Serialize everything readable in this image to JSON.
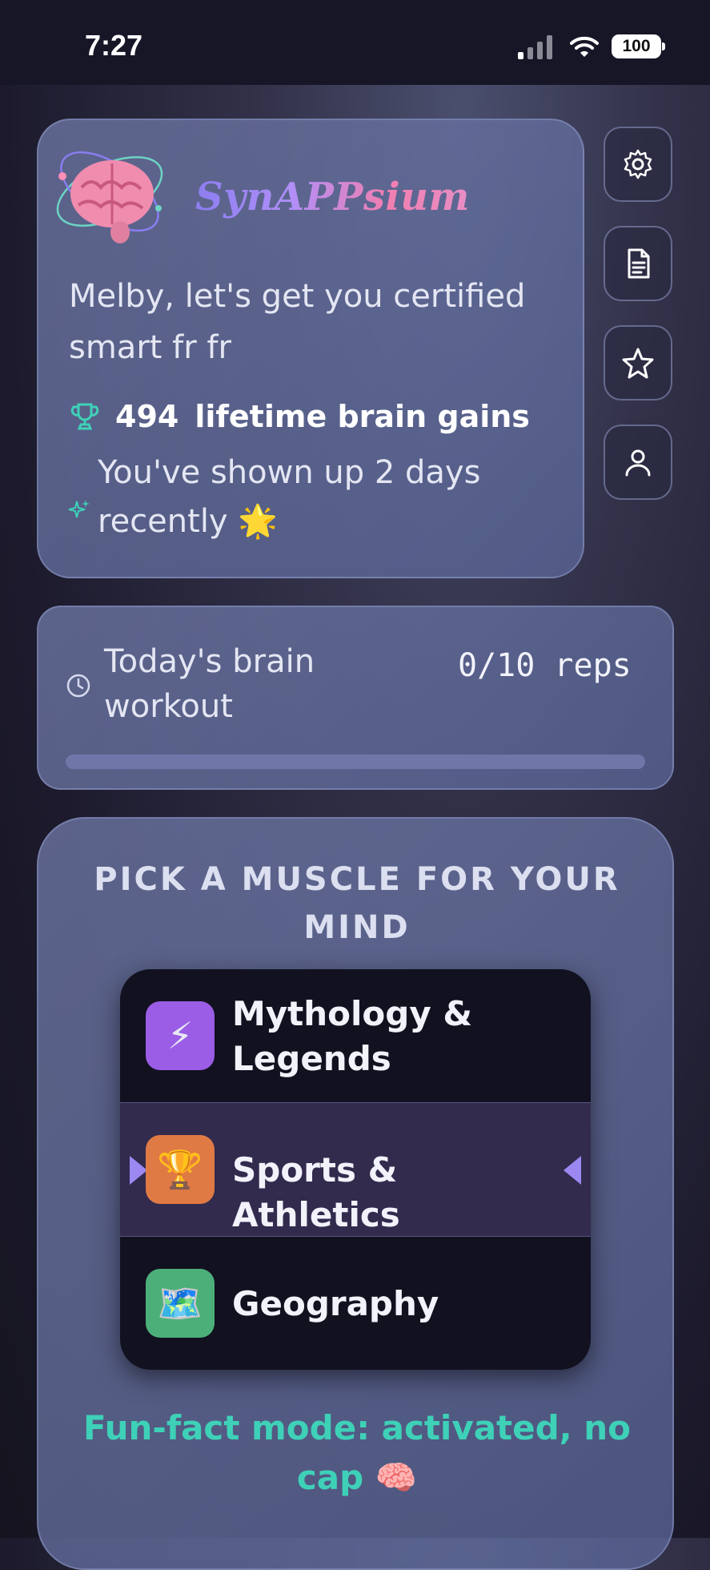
{
  "status_bar": {
    "time": "7:27",
    "battery": "100"
  },
  "header": {
    "app_name": "SynAPPsium",
    "greeting": "Melby, let's get you certified smart fr fr",
    "gains_count": "494",
    "gains_label": "lifetime brain gains",
    "streak_text": "You've shown up 2 days recently 🌟"
  },
  "side_buttons": [
    "settings-icon",
    "document-icon",
    "star-icon",
    "user-icon"
  ],
  "workout": {
    "label": "Today's brain workout",
    "reps": "0/10 reps",
    "progress": 0.0
  },
  "picker": {
    "title": "PICK A MUSCLE FOR YOUR MIND",
    "options": [
      {
        "label": "Mythology & Legends",
        "icon": "⚡",
        "color": "#9b5de5"
      },
      {
        "label": "Sports & Athletics",
        "icon": "🏆",
        "color": "#e07a45"
      },
      {
        "label": "Geography",
        "icon": "🗺️",
        "color": "#4caf7a"
      }
    ],
    "selected": "Sports & Athletics",
    "fun_fact": "Fun-fact mode: activated, no cap 🧠"
  },
  "colors": {
    "accent_teal": "#3ed1b8",
    "accent_purple": "#9d88f2"
  }
}
